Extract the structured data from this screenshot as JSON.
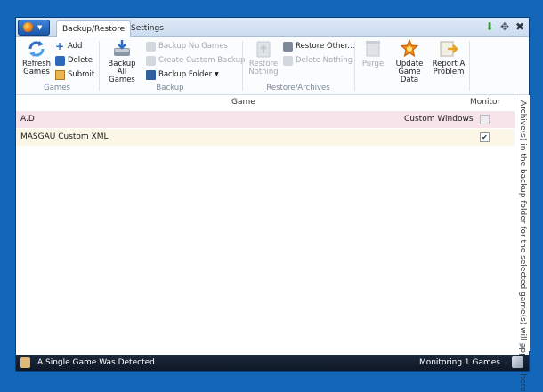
{
  "tabs": [
    {
      "label": "Backup/Restore",
      "active": true
    },
    {
      "label": "Settings",
      "active": false
    }
  ],
  "ribbon": {
    "games": {
      "label": "Games",
      "refresh": "Refresh\nGames",
      "add": "Add",
      "delete": "Delete",
      "submit": "Submit"
    },
    "backup": {
      "label": "Backup",
      "backup_all": "Backup All\nGames",
      "backup_no": "Backup No Games",
      "create_custom": "Create Custom Backup",
      "backup_folder": "Backup Folder"
    },
    "restore": {
      "label": "Restore/Archives",
      "restore_nothing": "Restore\nNothing",
      "restore_other": "Restore Other...",
      "delete_nothing": "Delete Nothing"
    },
    "misc": {
      "purge": "Purge",
      "update": "Update\nGame Data",
      "report": "Report A\nProblem"
    }
  },
  "list": {
    "headers": {
      "game": "Game",
      "monitor": "Monitor"
    },
    "rows": [
      {
        "name": "A.D",
        "info": "Custom Windows",
        "monitored": false
      },
      {
        "name": "MASGAU Custom XML",
        "info": "",
        "monitored": true
      }
    ],
    "side_text": "Archive(s) in the backup folder for the selected game(s) will appear here"
  },
  "status": {
    "left": "A Single Game Was Detected",
    "right": "Monitoring 1 Games"
  },
  "colors": {
    "background": "#1466b8",
    "status_bar": "#142032",
    "row1": "#f7e4ea",
    "row2": "#fbf6e6"
  }
}
